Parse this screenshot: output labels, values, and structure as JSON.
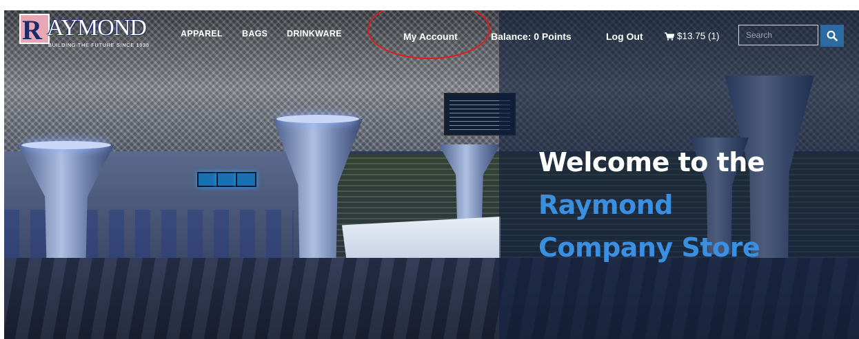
{
  "brand": {
    "logo_letter": "R",
    "logo_name": "AYMOND",
    "tagline": "BUILDING THE FUTURE SINCE 1938"
  },
  "nav": {
    "items": [
      {
        "label": "APPAREL"
      },
      {
        "label": "BAGS"
      },
      {
        "label": "DRINKWARE"
      }
    ]
  },
  "account": {
    "my_account": "My Account",
    "balance": "Balance: 0 Points",
    "logout": "Log Out"
  },
  "cart": {
    "summary": "$13.75 (1)"
  },
  "search": {
    "placeholder": "Search"
  },
  "hero": {
    "line1": "Welcome to the",
    "line2": "Raymond",
    "line3": "Company Store"
  },
  "colors": {
    "accent_blue": "#3b8fe0",
    "search_button": "#2d6aa0",
    "annotation_red": "#e41b1b"
  },
  "icons": {
    "cart": "cart-icon",
    "search": "search-icon"
  }
}
